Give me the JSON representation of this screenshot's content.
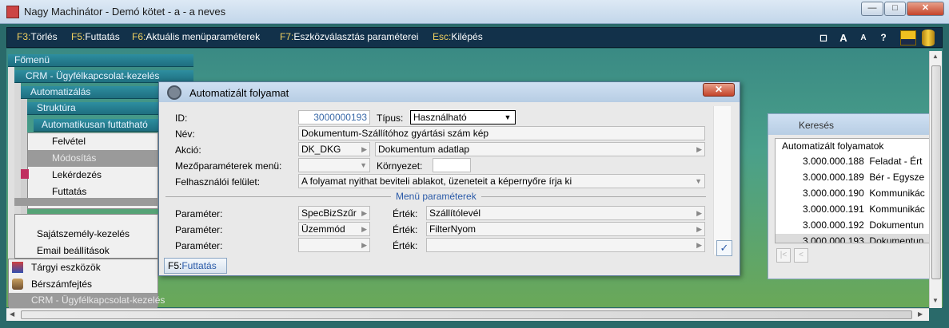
{
  "window": {
    "title": "Nagy Machinátor - Demó kötet - a - a neves",
    "controls": {
      "minimize": "—",
      "maximize": "□",
      "close": "✕"
    }
  },
  "toolbar": {
    "items": [
      {
        "key": "F3:",
        "label": "Törlés"
      },
      {
        "key": "F5:",
        "label": "Futtatás"
      },
      {
        "key": "F6:",
        "label": "Aktuális menüparaméterek"
      },
      {
        "key": "F7:",
        "label": "Eszközválasztás paraméterei"
      },
      {
        "key": "Esc:",
        "label": "Kilépés"
      }
    ],
    "icons": {
      "window": "◻",
      "font_large": "A",
      "font_small": "A",
      "help": "?"
    }
  },
  "menus": {
    "main": "Főmenü",
    "crm": "CRM - Ügyfélkapcsolat-kezelés",
    "automation": "Automatizálás",
    "structure": "Struktúra",
    "auto_run": "Automatikusan futtatható",
    "submenu": [
      "Felvétel",
      "Módosítás",
      "Lekérdezés",
      "Futtatás"
    ],
    "lower": [
      "Sajátszemély-kezelés",
      "Email beállítások"
    ],
    "bottom": [
      "Tárgyi eszközök",
      "Bérszámfejtés",
      "CRM - Ügyfélkapcsolat-kezelés"
    ]
  },
  "dialog": {
    "title": "Automatizált folyamat",
    "close": "✕",
    "id_label": "ID:",
    "id_value": "3000000193",
    "type_label": "Típus:",
    "type_value": "Használható",
    "name_label": "Név:",
    "name_value": "Dokumentum-Szállítóhoz gyártási szám kép",
    "action_label": "Akció:",
    "action_code": "DK_DKG",
    "action_value": "Dokumentum adatlap",
    "fieldparam_label": "Mezőparaméterek menü:",
    "env_label": "Környezet:",
    "ui_label": "Felhasználói felület:",
    "ui_value": "A folyamat nyithat beviteli ablakot, üzeneteit a képernyőre írja ki",
    "menu_params_title": "Menü paraméterek",
    "params": [
      {
        "label": "Paraméter:",
        "param": "SpecBizSzűr",
        "value_label": "Érték:",
        "value": "Szállítólevél"
      },
      {
        "label": "Paraméter:",
        "param": "Üzemmód",
        "value_label": "Érték:",
        "value": "FilterNyom"
      },
      {
        "label": "Paraméter:",
        "param": "",
        "value_label": "Érték:",
        "value": ""
      }
    ],
    "f5_key": "F5:",
    "f5_label": "Futtatás"
  },
  "search": {
    "title": "Keresés",
    "list_header": "Automatizált folyamatok",
    "rows": [
      {
        "id": "3.000.000.188",
        "name": "Feladat - Ért"
      },
      {
        "id": "3.000.000.189",
        "name": "Bér - Egysze"
      },
      {
        "id": "3.000.000.190",
        "name": "Kommunikác"
      },
      {
        "id": "3.000.000.191",
        "name": "Kommunikác"
      },
      {
        "id": "3.000.000.192",
        "name": "Dokumentun"
      },
      {
        "id": "3.000.000.193",
        "name": "Dokumentun",
        "selected": true
      }
    ]
  },
  "colors": {
    "accent": "#2a5aa8",
    "toolbar_bg": "#12314a",
    "fkey": "#f0d060"
  }
}
